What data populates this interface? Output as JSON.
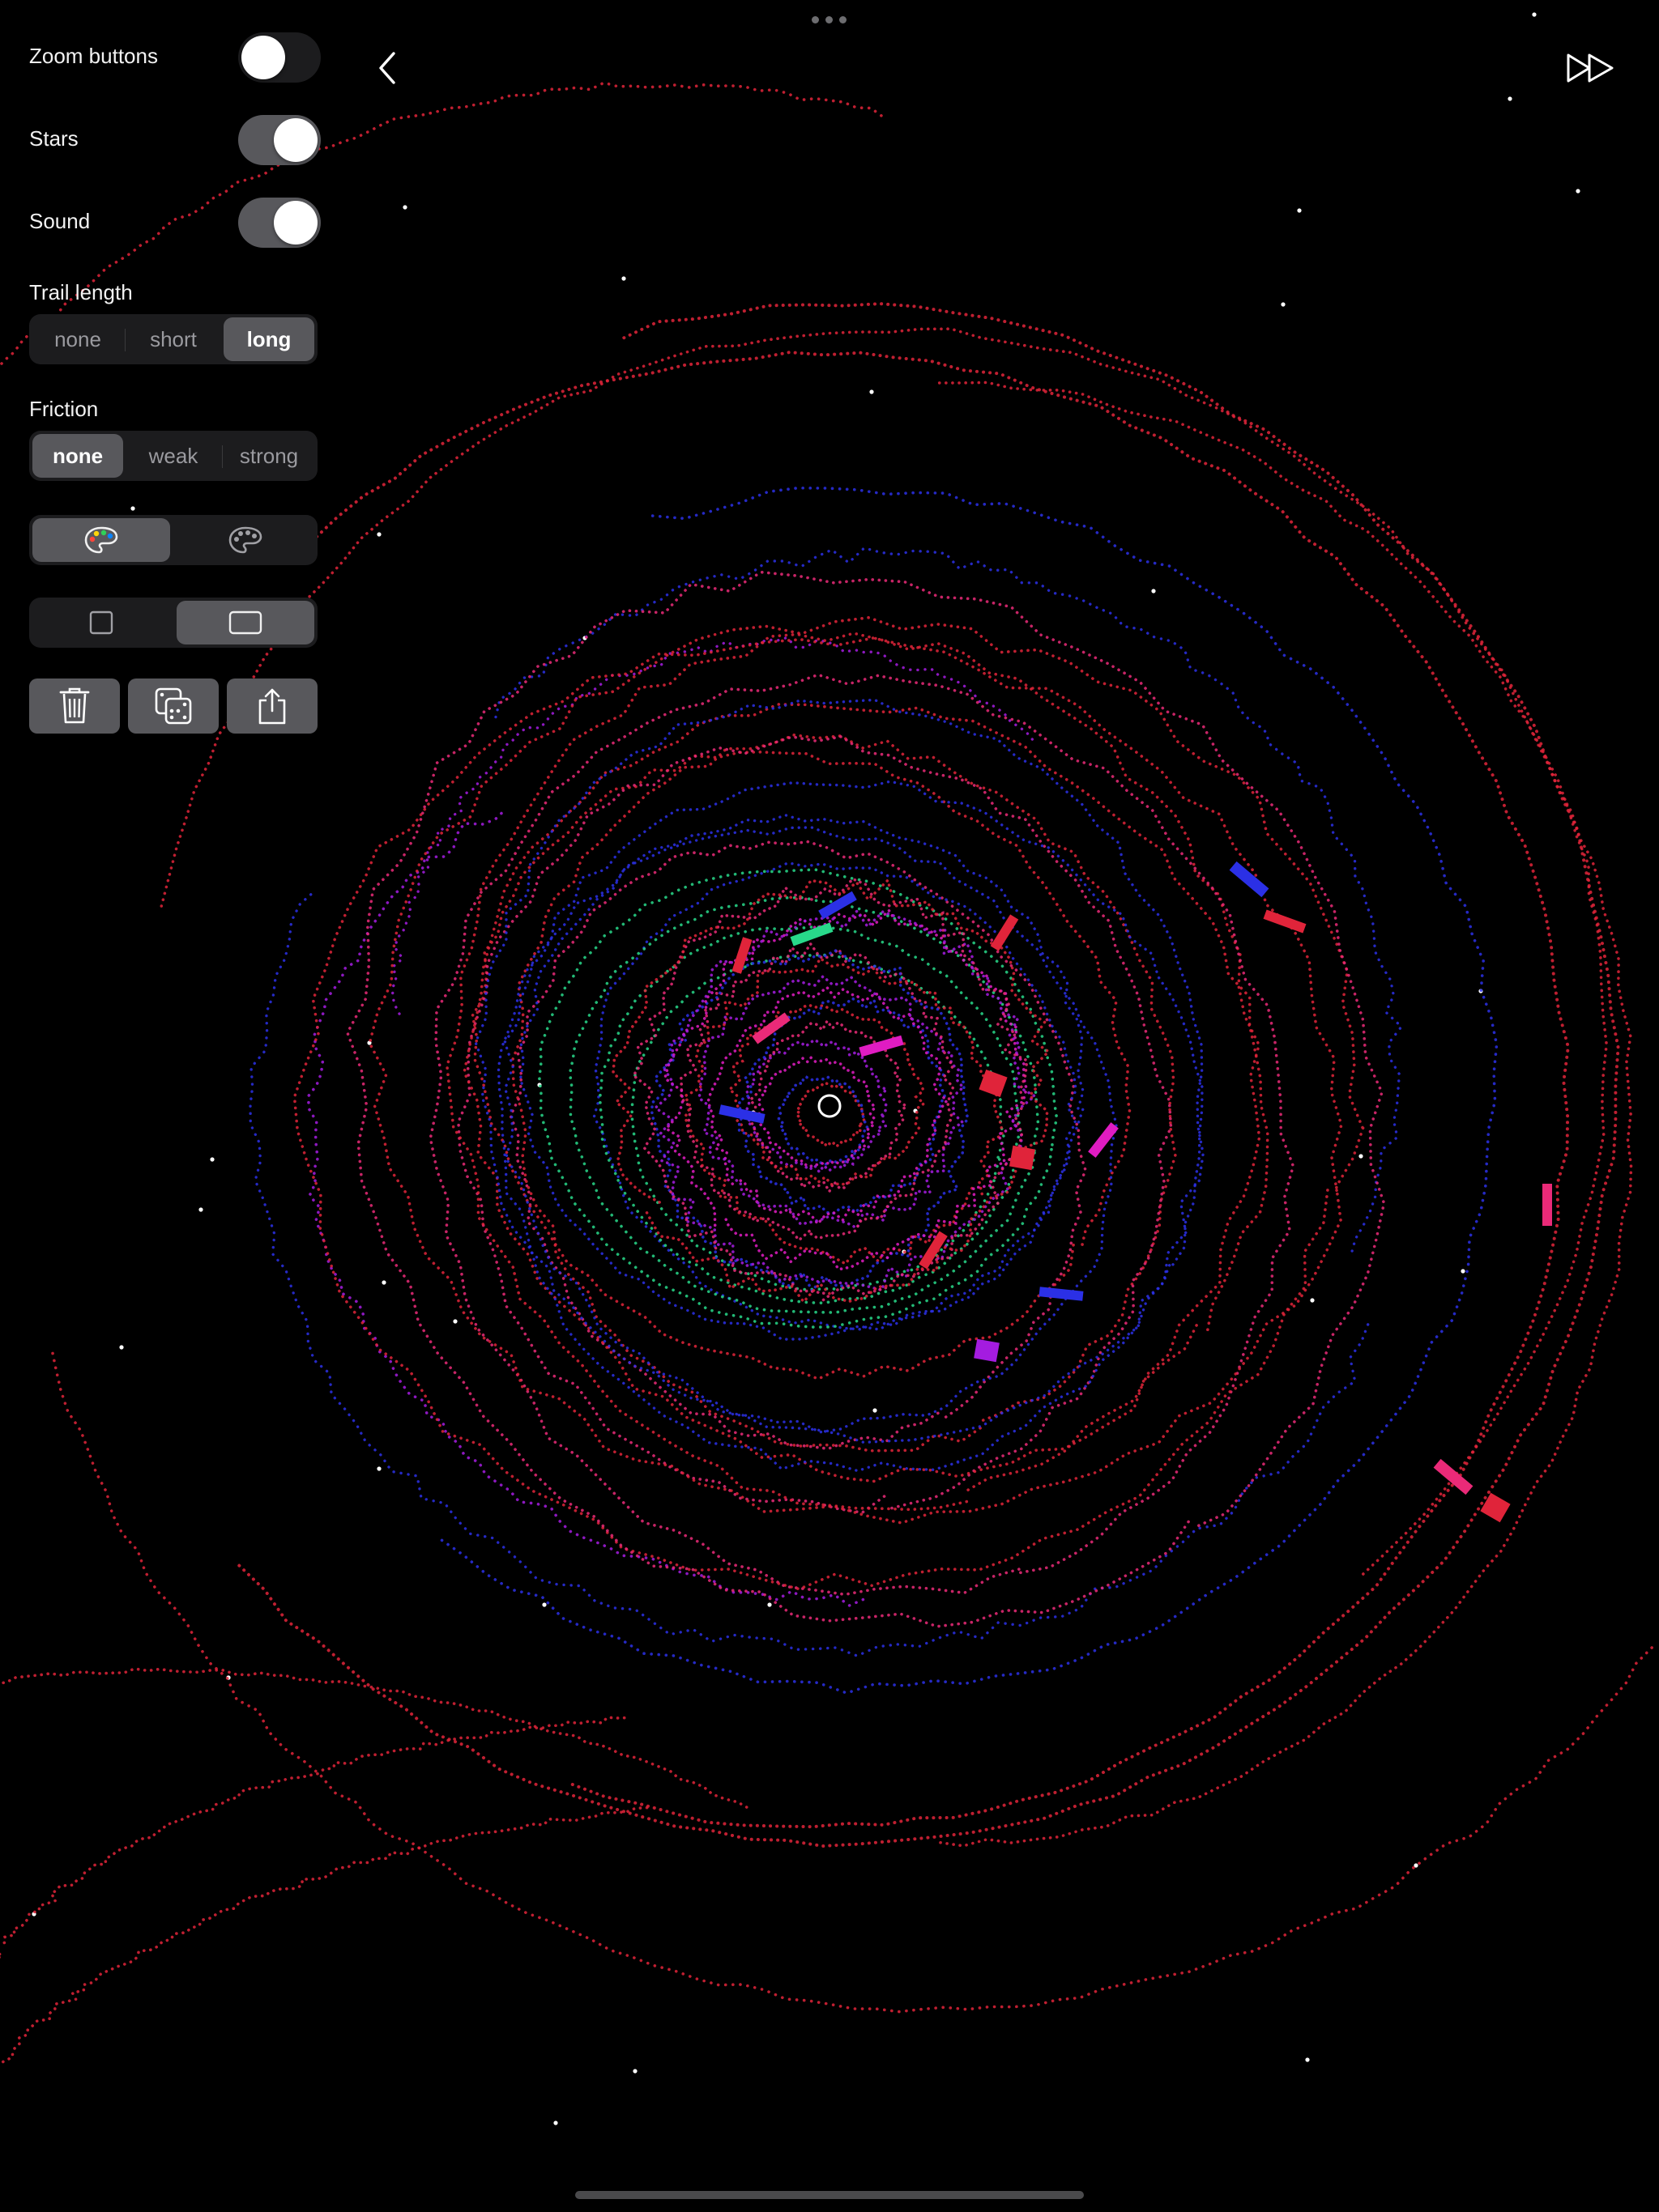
{
  "settings": {
    "zoom_buttons": {
      "label": "Zoom buttons",
      "on": false
    },
    "stars": {
      "label": "Stars",
      "on": true
    },
    "sound": {
      "label": "Sound",
      "on": true
    },
    "trail_length": {
      "label": "Trail length",
      "options": [
        "none",
        "short",
        "long"
      ],
      "selected": "long"
    },
    "friction": {
      "label": "Friction",
      "options": [
        "none",
        "weak",
        "strong"
      ],
      "selected": "none"
    },
    "color_mode": {
      "options": [
        "palette-color-icon",
        "palette-mono-icon"
      ],
      "selected": "palette-color-icon"
    },
    "aspect": {
      "options": [
        "square-icon",
        "wide-rectangle-icon"
      ],
      "selected": "wide-rectangle-icon"
    }
  },
  "actions": [
    "trash-icon",
    "dice-icon",
    "share-icon"
  ],
  "toolbar": {
    "back": "chevron-left-icon",
    "fast_forward": "fast-forward-icon"
  },
  "colors": {
    "red": "#e0243a",
    "blue": "#2b30e6",
    "magenta": "#e01cc2",
    "purple": "#a41ce0",
    "green": "#28d88a",
    "pink": "#ea2a78",
    "control_bg": "#1c1c1e",
    "control_selected": "#58585c"
  }
}
